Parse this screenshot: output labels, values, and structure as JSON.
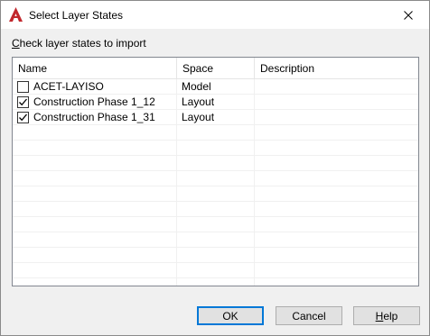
{
  "window": {
    "title": "Select Layer States",
    "app_icon": "autocad-a-icon",
    "close_icon": "close-icon"
  },
  "instruction": {
    "accel": "C",
    "rest": "heck layer states to import"
  },
  "table": {
    "columns": [
      "Name",
      "Space",
      "Description"
    ],
    "rows": [
      {
        "checked": false,
        "name": "ACET-LAYISO",
        "space": "Model",
        "description": ""
      },
      {
        "checked": true,
        "name": "Construction Phase 1_12",
        "space": "Layout",
        "description": ""
      },
      {
        "checked": true,
        "name": "Construction Phase 1_31",
        "space": "Layout",
        "description": ""
      }
    ]
  },
  "buttons": {
    "ok": "OK",
    "cancel": "Cancel",
    "help_accel": "H",
    "help_rest": "elp"
  },
  "colors": {
    "accent": "#0078d7",
    "autocad_red": "#c1272d"
  }
}
